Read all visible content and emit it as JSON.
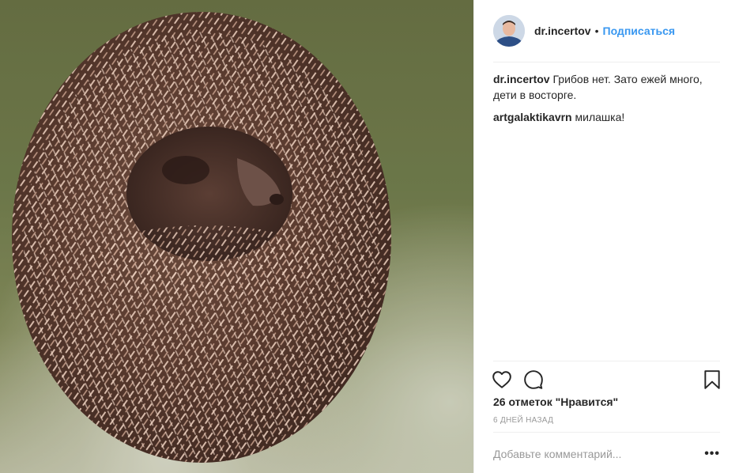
{
  "post": {
    "image_alt": "hedgehog-photo"
  },
  "header": {
    "username": "dr.incertov",
    "separator": "•",
    "follow_label": "Подписаться"
  },
  "comments": [
    {
      "author": "dr.incertov",
      "text": "Грибов нет. Зато ежей много, дети в восторге."
    },
    {
      "author": "artgalaktikavrn",
      "text": "милашка!"
    }
  ],
  "actions": {
    "like_icon": "heart-icon",
    "comment_icon": "comment-bubble-icon",
    "save_icon": "bookmark-icon"
  },
  "likes_text": "26 отметок \"Нравится\"",
  "date_text": "6 дней назад",
  "comment_box": {
    "placeholder": "Добавьте комментарий...",
    "more_label": "•••"
  },
  "colors": {
    "accent": "#3897f0",
    "text": "#262626",
    "muted": "#999999",
    "divider": "#efefef"
  }
}
